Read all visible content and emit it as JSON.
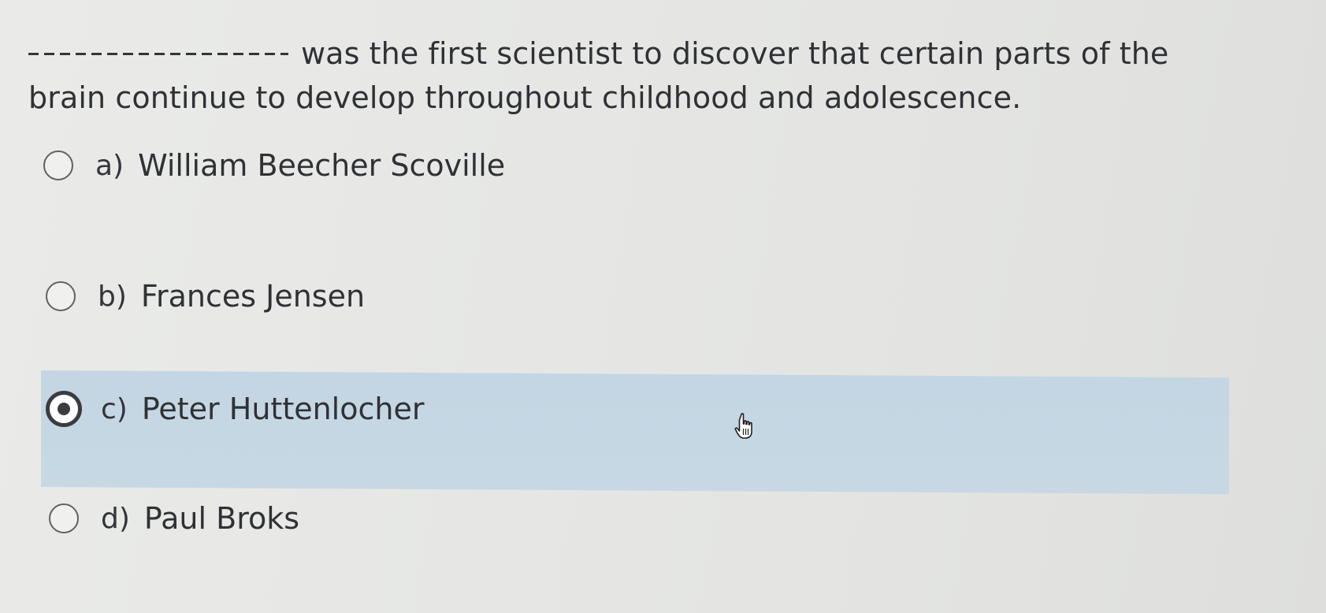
{
  "question": {
    "text": "was the first scientist to discover that certain parts of the brain continue to develop throughout childhood and adolescence."
  },
  "options": [
    {
      "letter": "a)",
      "text": "William Beecher Scoville",
      "selected": false
    },
    {
      "letter": "b)",
      "text": "Frances Jensen",
      "selected": false
    },
    {
      "letter": "c)",
      "text": "Peter Huttenlocher",
      "selected": true
    },
    {
      "letter": "d)",
      "text": "Paul Broks",
      "selected": false
    }
  ],
  "colors": {
    "selected_background": "#c4d6e3",
    "radio_border": "#5f6266",
    "text": "#2f3135"
  },
  "icons": {
    "cursor": "hand-pointer-icon"
  }
}
